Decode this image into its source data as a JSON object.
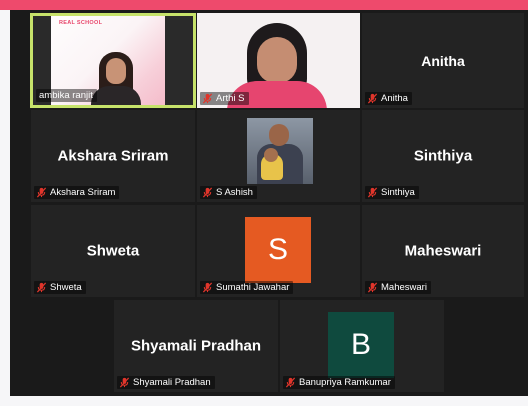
{
  "colors": {
    "accent_bar": "#ee4a6c",
    "active_speaker_border": "#c6e26a",
    "muted_mic": "#e0352b",
    "avatar_s": "#e55a22",
    "avatar_b": "#0f4a3e"
  },
  "participants": [
    {
      "id": "ambika",
      "display_name": "ambika ranjit",
      "video": true,
      "muted": false,
      "active": true,
      "brand_text": "REAL SCHOOL"
    },
    {
      "id": "arthi",
      "display_name": "Arthi S",
      "video": true,
      "muted": true
    },
    {
      "id": "anitha",
      "center_name": "Anitha",
      "display_name": "Anitha",
      "muted": true
    },
    {
      "id": "akshara",
      "center_name": "Akshara Sriram",
      "display_name": "Akshara Sriram",
      "muted": true
    },
    {
      "id": "ashish",
      "display_name": "S Ashish",
      "photo": true,
      "muted": true
    },
    {
      "id": "sinthiya",
      "center_name": "Sinthiya",
      "display_name": "Sinthiya",
      "muted": true
    },
    {
      "id": "shweta",
      "center_name": "Shweta",
      "display_name": "Shweta",
      "muted": true
    },
    {
      "id": "sumathi",
      "avatar_letter": "S",
      "display_name": "Sumathi Jawahar",
      "muted": true
    },
    {
      "id": "maheswari",
      "center_name": "Maheswari",
      "display_name": "Maheswari",
      "muted": true
    },
    {
      "id": "shyamali",
      "center_name": "Shyamali Pradhan",
      "display_name": "Shyamali Pradhan",
      "muted": true
    },
    {
      "id": "banupriya",
      "avatar_letter": "B",
      "display_name": "Banupriya Ramkumar",
      "muted": true
    }
  ]
}
